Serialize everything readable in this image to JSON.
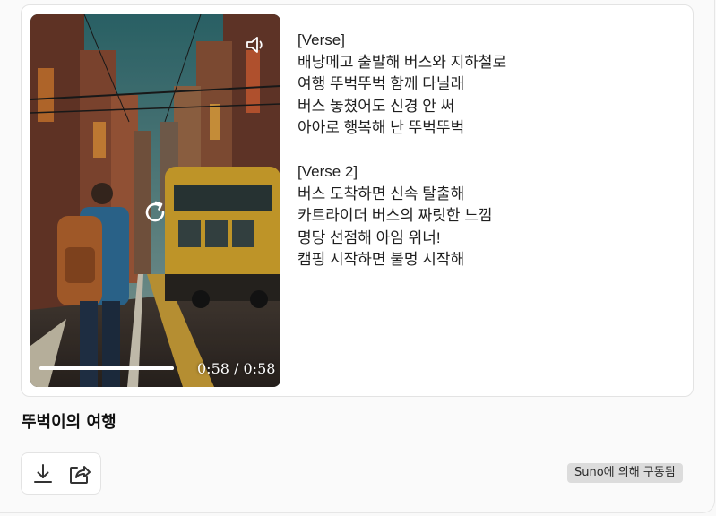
{
  "player": {
    "time_display": "0:58 / 0:58",
    "progress_fraction": 1.0
  },
  "lyrics": [
    "[Verse]",
    "배낭메고 출발해 버스와 지하철로",
    "여행 뚜벅뚜벅 함께 다닐래",
    "버스 놓쳤어도 신경 안 써",
    "아아로 행복해 난 뚜벅뚜벅",
    "",
    "[Verse 2]",
    "버스 도착하면 신속 탈출해",
    "카트라이더 버스의 짜릿한 느낌",
    "명당 선점해 아임 위너!",
    "캠핑 시작하면 불멍 시작해"
  ],
  "song": {
    "title": "뚜벅이의 여행"
  },
  "actions": {
    "download_icon": "download-icon",
    "share_icon": "share-icon"
  },
  "badge": {
    "label": "Suno에 의해 구동됨"
  },
  "icons": {
    "volume": "volume-icon",
    "replay": "replay-icon"
  }
}
